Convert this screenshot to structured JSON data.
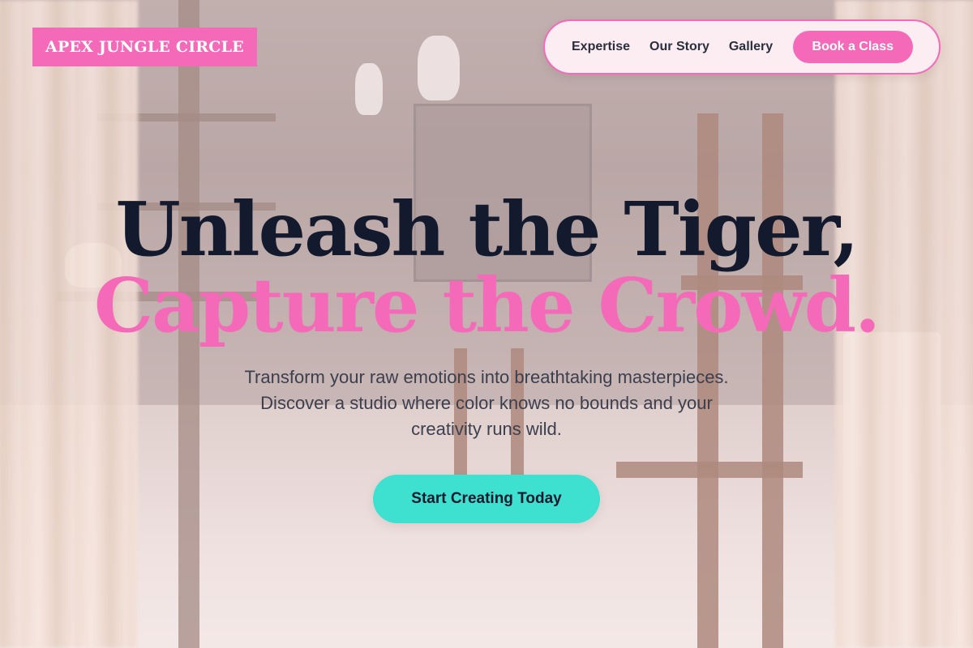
{
  "brand": {
    "logo_text": "APEX JUNGLE CIRCLE"
  },
  "nav": {
    "links": [
      "Expertise",
      "Our Story",
      "Gallery"
    ],
    "cta_label": "Book a Class"
  },
  "hero": {
    "title_line1": "Unleash the Tiger,",
    "title_line2": "Capture the Crowd.",
    "subtitle": "Transform your raw emotions into breathtaking masterpieces. Discover a studio where color knows no bounds and your creativity runs wild.",
    "cta_label": "Start Creating Today"
  },
  "colors": {
    "accent_pink": "#f46ab8",
    "accent_teal": "#3ee0d0",
    "title_dark": "#141a2e"
  }
}
